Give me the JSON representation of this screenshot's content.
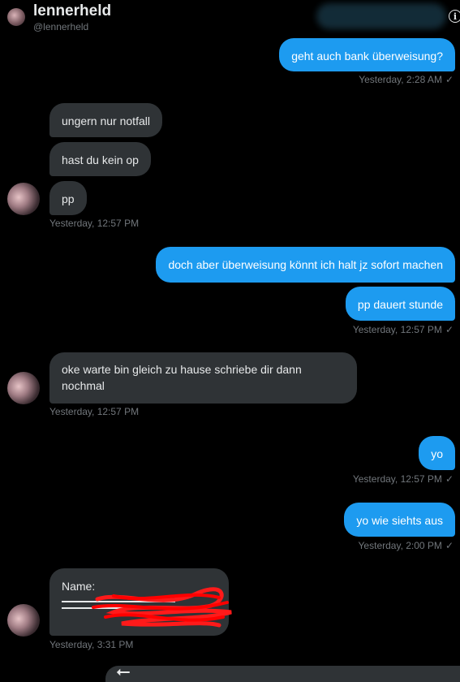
{
  "header": {
    "name": "lennerheld",
    "handle": "@lennerheld",
    "info_icon": "i"
  },
  "messages": [
    {
      "text": "geht auch bank überweisung?"
    },
    {
      "text": "ungern nur notfall"
    },
    {
      "text": "hast du kein op"
    },
    {
      "text": "pp"
    },
    {
      "text": "doch aber überweisung könnt ich halt jz sofort machen"
    },
    {
      "text": "pp dauert stunde"
    },
    {
      "text": "oke warte bin gleich zu hause schriebe dir dann nochmal"
    },
    {
      "text": "yo"
    },
    {
      "text": "yo wie siehts aus"
    },
    {
      "text": "Name:"
    }
  ],
  "timestamps": {
    "t1": "Yesterday, 2:28 AM",
    "t2": "Yesterday, 12:57 PM",
    "t3": "Yesterday, 12:57 PM",
    "t4": "Yesterday, 12:57 PM",
    "t5": "Yesterday, 12:57 PM",
    "t6": "Yesterday, 2:00 PM",
    "t7": "Yesterday, 3:31 PM"
  },
  "check": "✓",
  "composer": {
    "back_icon": "⭠"
  }
}
